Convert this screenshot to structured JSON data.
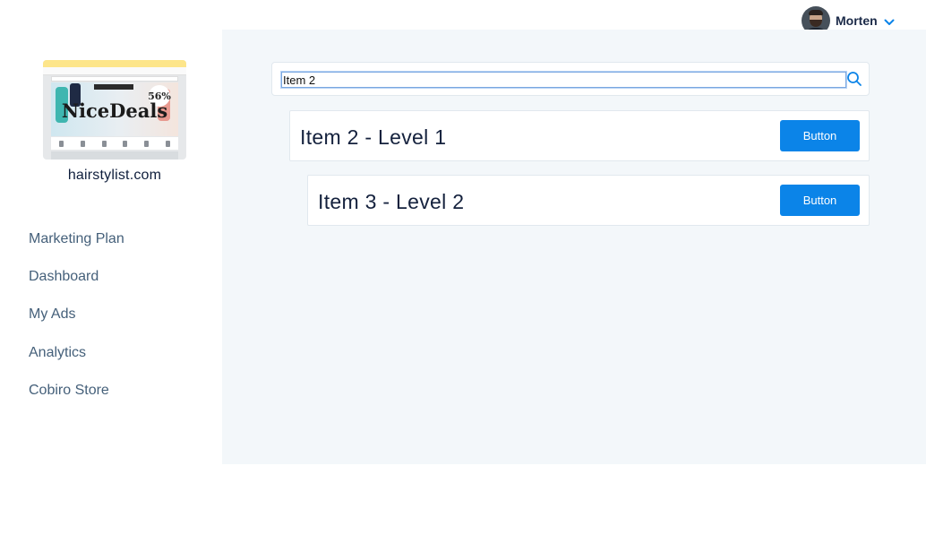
{
  "user": {
    "name": "Morten"
  },
  "site": {
    "name": "hairstylist.com",
    "thumbnail_brand": "NiceDeals",
    "thumbnail_badge": "56%"
  },
  "sidebar": {
    "items": [
      {
        "label": "Marketing Plan"
      },
      {
        "label": "Dashboard"
      },
      {
        "label": "My Ads"
      },
      {
        "label": "Analytics"
      },
      {
        "label": "Cobiro Store"
      }
    ]
  },
  "search": {
    "value": "Item 2"
  },
  "items": [
    {
      "title": "Item 2 - Level 1",
      "button_label": "Button"
    },
    {
      "title": "Item 3 - Level 2",
      "button_label": "Button"
    }
  ],
  "colors": {
    "accent": "#0b84e8",
    "panel_bg": "#f3f7fa",
    "text_dark": "#14213d",
    "menu_text": "#45607a"
  }
}
